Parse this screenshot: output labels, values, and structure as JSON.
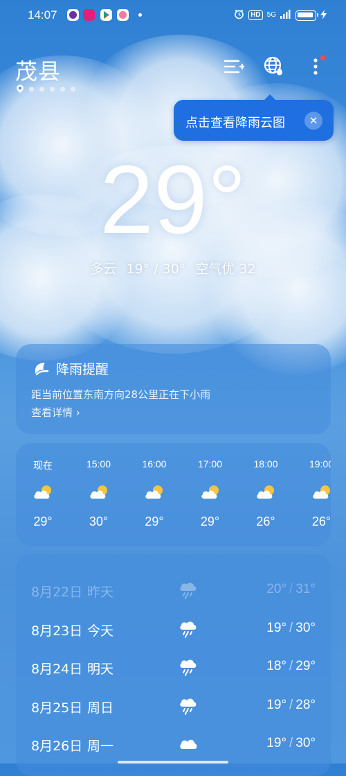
{
  "status_bar": {
    "time": "14:07",
    "network": "5G",
    "hd": "HD",
    "notification_app_icons": [
      "chat-app-icon",
      "shop-app-icon",
      "play-store-icon",
      "flower-app-icon"
    ]
  },
  "header": {
    "city": "茂县",
    "page_count": 5,
    "icons": [
      "city-list-icon",
      "radar-map-icon",
      "more-menu-icon"
    ]
  },
  "tooltip": {
    "text": "点击查看降雨云图",
    "close_glyph": "✕"
  },
  "current": {
    "temp": "29°",
    "condition": "多云",
    "range": "19° / 30°",
    "aqi": "空气优 32"
  },
  "rain_alert": {
    "title": "降雨提醒",
    "description": "距当前位置东南方向28公里正在下小雨",
    "link": "查看详情 ›"
  },
  "hourly": [
    {
      "time": "现在",
      "icon": "partly-cloudy-icon",
      "temp": "29°"
    },
    {
      "time": "15:00",
      "icon": "partly-cloudy-icon",
      "temp": "30°"
    },
    {
      "time": "16:00",
      "icon": "partly-cloudy-icon",
      "temp": "29°"
    },
    {
      "time": "17:00",
      "icon": "partly-cloudy-icon",
      "temp": "29°"
    },
    {
      "time": "18:00",
      "icon": "partly-cloudy-icon",
      "temp": "26°"
    },
    {
      "time": "19:00",
      "icon": "partly-cloudy-icon",
      "temp": "26°"
    }
  ],
  "daily": [
    {
      "date": "8月22日",
      "weekday": "昨天",
      "icon": "rain-icon",
      "low": "20°",
      "high": "31°",
      "past": true
    },
    {
      "date": "8月23日",
      "weekday": "今天",
      "icon": "rain-icon",
      "low": "19°",
      "high": "30°",
      "past": false
    },
    {
      "date": "8月24日",
      "weekday": "明天",
      "icon": "rain-icon",
      "low": "18°",
      "high": "29°",
      "past": false
    },
    {
      "date": "8月25日",
      "weekday": "周日",
      "icon": "rain-icon",
      "low": "19°",
      "high": "28°",
      "past": false
    },
    {
      "date": "8月26日",
      "weekday": "周一",
      "icon": "cloudy-icon",
      "low": "19°",
      "high": "30°",
      "past": false
    }
  ],
  "colors": {
    "tooltip_bg": "#1f6fe0",
    "notification_dot": "#ff4a4a",
    "sun": "#f5c542"
  }
}
